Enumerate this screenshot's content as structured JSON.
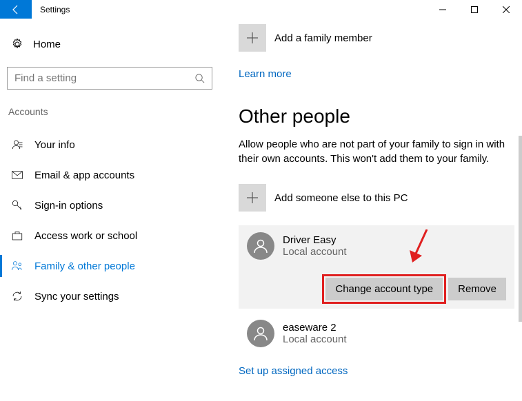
{
  "titlebar": {
    "title": "Settings"
  },
  "sidebar": {
    "home_label": "Home",
    "search_placeholder": "Find a setting",
    "section": "Accounts",
    "items": [
      {
        "label": "Your info"
      },
      {
        "label": "Email & app accounts"
      },
      {
        "label": "Sign-in options"
      },
      {
        "label": "Access work or school"
      },
      {
        "label": "Family & other people"
      },
      {
        "label": "Sync your settings"
      }
    ]
  },
  "main": {
    "add_family_label": "Add a family member",
    "learn_more": "Learn more",
    "other_people_heading": "Other people",
    "other_people_desc": "Allow people who are not part of your family to sign in with their own accounts. This won't add them to your family.",
    "add_other_label": "Add someone else to this PC",
    "users": [
      {
        "name": "Driver Easy",
        "type": "Local account"
      },
      {
        "name": "easeware 2",
        "type": "Local account"
      }
    ],
    "change_btn": "Change account type",
    "remove_btn": "Remove",
    "assigned_access": "Set up assigned access"
  }
}
